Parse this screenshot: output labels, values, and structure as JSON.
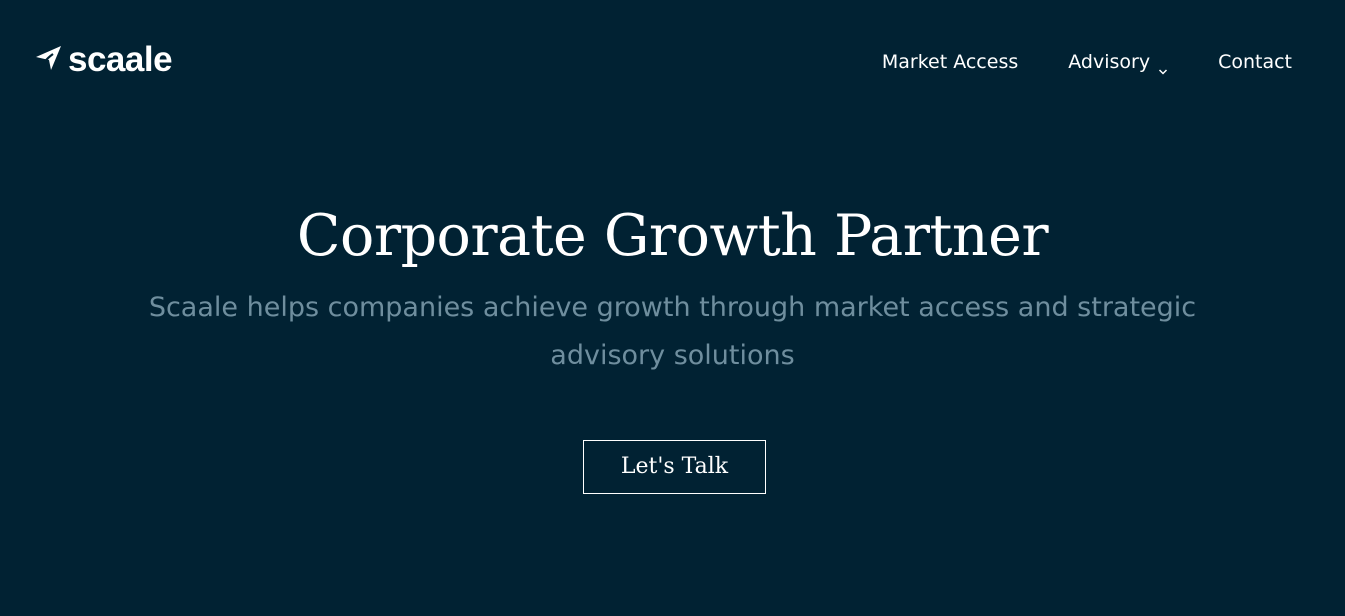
{
  "brand": {
    "name": "scaale",
    "logo_icon": "paper-plane-swoosh-icon"
  },
  "nav": {
    "items": [
      {
        "label": "Market Access"
      },
      {
        "label": "Advisory",
        "icon": "chevron-down-icon"
      },
      {
        "label": "Contact"
      }
    ]
  },
  "hero": {
    "title": "Corporate Growth Partner",
    "subtitle": "Scaale helps companies achieve growth through market access and strategic advisory solutions",
    "cta_label": "Let's Talk"
  },
  "colors": {
    "background": "#012233",
    "text": "#ffffff",
    "subtitle": "#6f8e9e"
  }
}
